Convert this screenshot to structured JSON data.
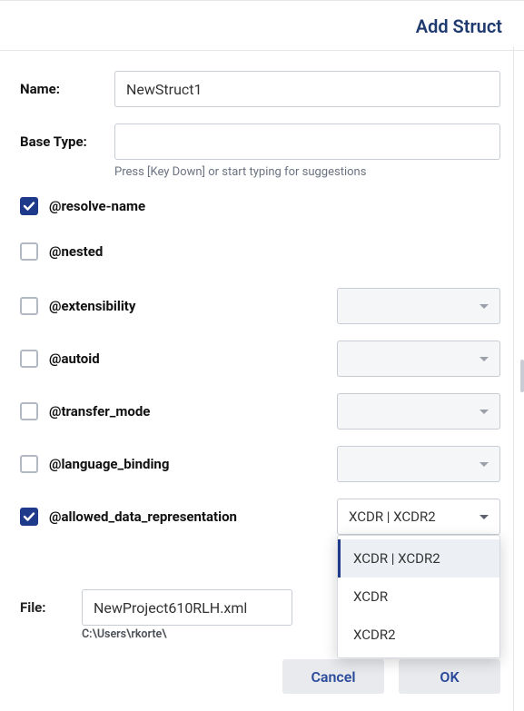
{
  "header": {
    "title": "Add Struct"
  },
  "form": {
    "name_label": "Name:",
    "name_value": "NewStruct1",
    "base_type_label": "Base Type:",
    "base_type_value": "",
    "base_type_hint": "Press [Key Down] or start typing for suggestions"
  },
  "options": [
    {
      "key": "resolve_name",
      "label": "@resolve-name",
      "checked": true,
      "has_select": false
    },
    {
      "key": "nested",
      "label": "@nested",
      "checked": false,
      "has_select": false
    },
    {
      "key": "extensibility",
      "label": "@extensibility",
      "checked": false,
      "has_select": true,
      "select_value": ""
    },
    {
      "key": "autoid",
      "label": "@autoid",
      "checked": false,
      "has_select": true,
      "select_value": ""
    },
    {
      "key": "transfer_mode",
      "label": "@transfer_mode",
      "checked": false,
      "has_select": true,
      "select_value": ""
    },
    {
      "key": "language_binding",
      "label": "@language_binding",
      "checked": false,
      "has_select": true,
      "select_value": ""
    },
    {
      "key": "allowed_data_representation",
      "label": "@allowed_data_representation",
      "checked": true,
      "has_select": true,
      "select_value": "XCDR | XCDR2"
    }
  ],
  "dropdown": {
    "items": [
      {
        "label": "XCDR | XCDR2",
        "highlight": true
      },
      {
        "label": "XCDR",
        "highlight": false
      },
      {
        "label": "XCDR2",
        "highlight": false
      }
    ]
  },
  "file": {
    "label": "File:",
    "value": "NewProject610RLH.xml",
    "path": "C:\\Users\\rkorte\\"
  },
  "actions": {
    "cancel": "Cancel",
    "ok": "OK"
  }
}
